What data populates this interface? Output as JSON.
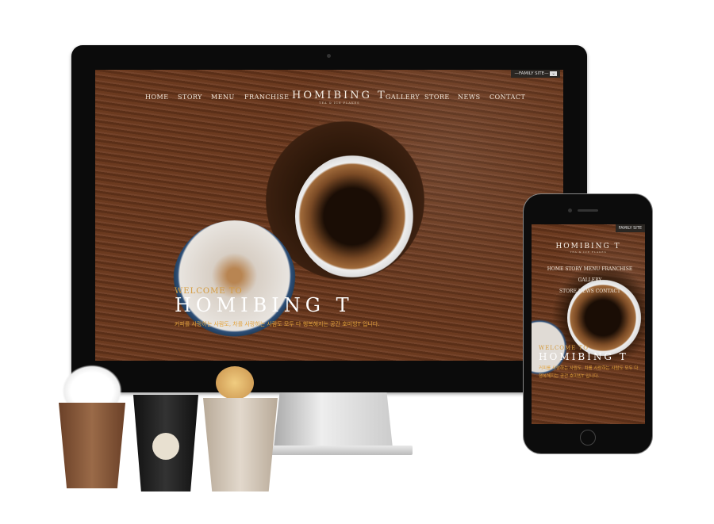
{
  "desktop": {
    "family_site": "FAMILY SITE",
    "nav_left": [
      "HOME",
      "STORY",
      "MENU",
      "FRANCHISE"
    ],
    "nav_right": [
      "GALLERY",
      "STORE",
      "NEWS",
      "CONTACT"
    ],
    "logo": "HOMIBING T",
    "logo_tagline": "TEA & ICE FLAKES",
    "hero": {
      "welcome": "WELCOME TO",
      "title": "HOMIBING T",
      "description": "커피를 사랑하는 사람도, 차를 사랑하는 사람도 모두 다 행복해지는 공간 호미빙T 입니다."
    }
  },
  "mobile": {
    "family_site": "FAMILY SITE",
    "logo": "HOMIBING T",
    "logo_tagline": "TEA & ICE FLAKES",
    "nav": [
      "HOME",
      "STORY",
      "MENU",
      "FRANCHISE",
      "GALLERY",
      "STORE",
      "NEWS",
      "CONTACT"
    ],
    "hero": {
      "welcome": "WELCOME TO",
      "title": "HOMIBING T",
      "description": "커피를 사랑하는 사람도, 차를 사랑하는 사람도 모두 다 행복해지는 공간 호미빙T 입니다."
    }
  },
  "colors": {
    "accent": "#d49a3c",
    "wood": "#5e321b"
  }
}
